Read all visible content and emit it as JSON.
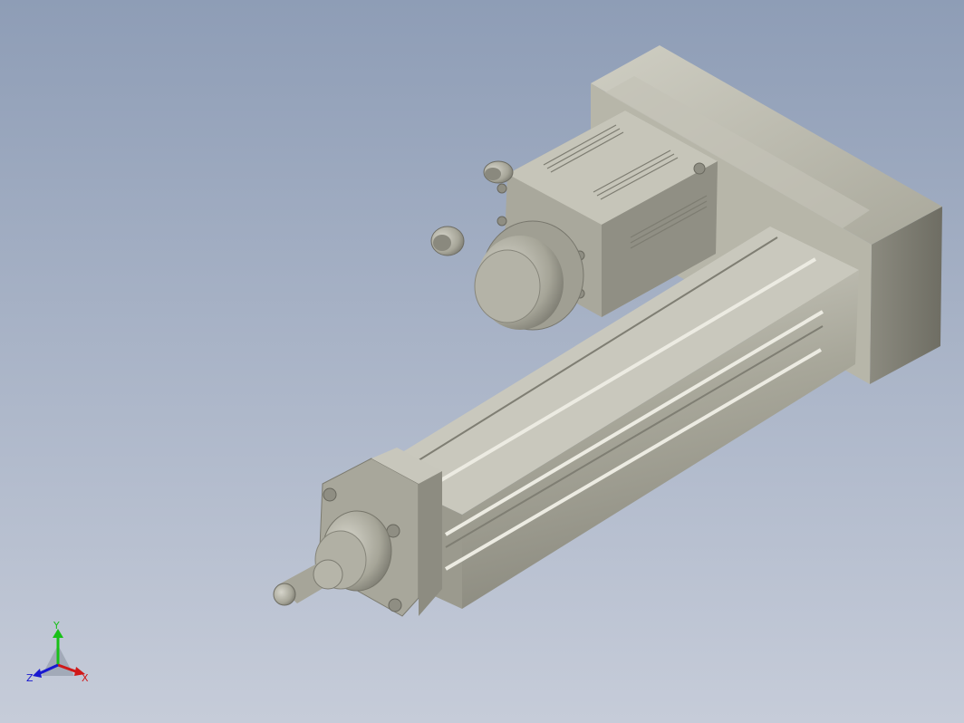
{
  "viewport": {
    "background_top": "#8e9db6",
    "background_bottom": "#c6ccd9",
    "model": {
      "parts": [
        "motor-block",
        "servo-motor",
        "motor-encoder",
        "motor-connectors",
        "actuator-body",
        "front-end-cap",
        "piston-rod"
      ],
      "metal_color": "#b9b8aa",
      "shadow_color": "#6e6d63"
    }
  },
  "triad": {
    "x_label": "X",
    "y_label": "Y",
    "z_label": "Z",
    "x_color": "#d01818",
    "y_color": "#18c018",
    "z_color": "#1818d0"
  }
}
